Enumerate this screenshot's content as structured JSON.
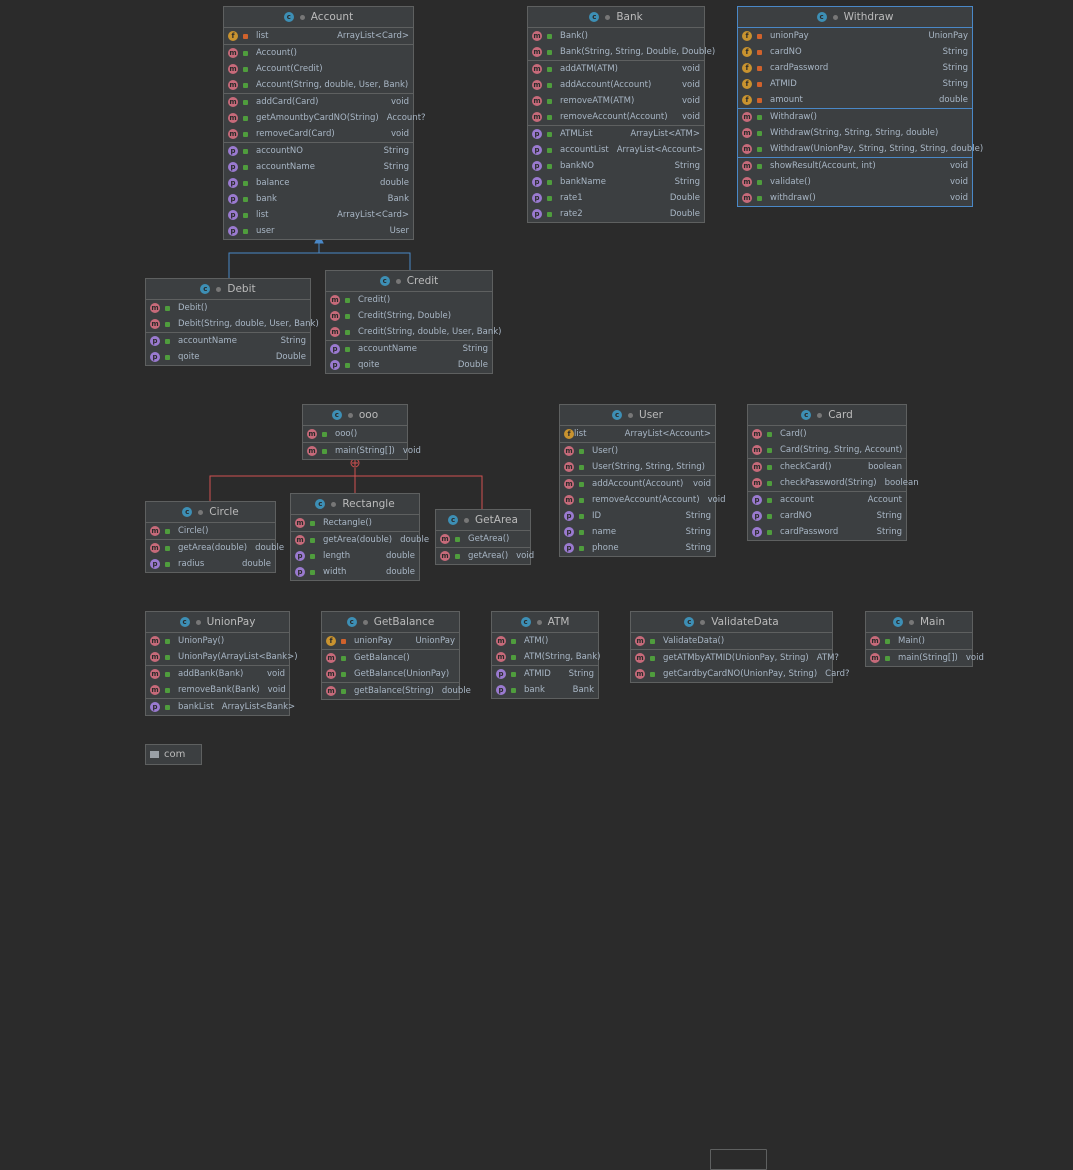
{
  "colors": {
    "background": "#2b2b2b",
    "box": "#3c3f41",
    "inheritance": "#4a88c7",
    "inner": "#d05050",
    "selection": "#4a88c7"
  },
  "classes": [
    {
      "id": "Account",
      "title": "Account",
      "sections": [
        [
          {
            "k": "f",
            "v": "priv",
            "name": "list",
            "type": "ArrayList<Card>"
          }
        ],
        [
          {
            "k": "m",
            "v": "pub",
            "name": "Account()",
            "type": ""
          },
          {
            "k": "m",
            "v": "pub",
            "name": "Account(Credit)",
            "type": ""
          },
          {
            "k": "m",
            "v": "pub",
            "name": "Account(String, double, User, Bank)",
            "type": ""
          }
        ],
        [
          {
            "k": "m",
            "v": "pub",
            "name": "addCard(Card)",
            "type": "void"
          },
          {
            "k": "m",
            "v": "pub",
            "name": "getAmountbyCardNO(String)",
            "type": "Account?"
          },
          {
            "k": "m",
            "v": "pub",
            "name": "removeCard(Card)",
            "type": "void"
          }
        ],
        [
          {
            "k": "p",
            "v": "pub",
            "name": "accountNO",
            "type": "String"
          },
          {
            "k": "p",
            "v": "pub",
            "name": "accountName",
            "type": "String"
          },
          {
            "k": "p",
            "v": "pub",
            "name": "balance",
            "type": "double"
          },
          {
            "k": "p",
            "v": "pub",
            "name": "bank",
            "type": "Bank"
          },
          {
            "k": "p",
            "v": "pub",
            "name": "list",
            "type": "ArrayList<Card>"
          },
          {
            "k": "p",
            "v": "pub",
            "name": "user",
            "type": "User"
          }
        ]
      ]
    },
    {
      "id": "Bank",
      "title": "Bank",
      "sections": [
        [
          {
            "k": "m",
            "v": "pub",
            "name": "Bank()",
            "type": ""
          },
          {
            "k": "m",
            "v": "pub",
            "name": "Bank(String, String, Double, Double)",
            "type": ""
          }
        ],
        [
          {
            "k": "m",
            "v": "pub",
            "name": "addATM(ATM)",
            "type": "void"
          },
          {
            "k": "m",
            "v": "pub",
            "name": "addAccount(Account)",
            "type": "void"
          },
          {
            "k": "m",
            "v": "pub",
            "name": "removeATM(ATM)",
            "type": "void"
          },
          {
            "k": "m",
            "v": "pub",
            "name": "removeAccount(Account)",
            "type": "void"
          }
        ],
        [
          {
            "k": "p",
            "v": "pub",
            "name": "ATMList",
            "type": "ArrayList<ATM>"
          },
          {
            "k": "p",
            "v": "pub",
            "name": "accountList",
            "type": "ArrayList<Account>"
          },
          {
            "k": "p",
            "v": "pub",
            "name": "bankNO",
            "type": "String"
          },
          {
            "k": "p",
            "v": "pub",
            "name": "bankName",
            "type": "String"
          },
          {
            "k": "p",
            "v": "pub",
            "name": "rate1",
            "type": "Double"
          },
          {
            "k": "p",
            "v": "pub",
            "name": "rate2",
            "type": "Double"
          }
        ]
      ]
    },
    {
      "id": "Withdraw",
      "title": "Withdraw",
      "selected": true,
      "sections": [
        [
          {
            "k": "f",
            "v": "priv",
            "name": "unionPay",
            "type": "UnionPay"
          },
          {
            "k": "f",
            "v": "priv",
            "name": "cardNO",
            "type": "String"
          },
          {
            "k": "f",
            "v": "priv",
            "name": "cardPassword",
            "type": "String"
          },
          {
            "k": "f",
            "v": "priv",
            "name": "ATMID",
            "type": "String"
          },
          {
            "k": "f",
            "v": "priv",
            "name": "amount",
            "type": "double"
          }
        ],
        [
          {
            "k": "m",
            "v": "pub",
            "name": "Withdraw()",
            "type": ""
          },
          {
            "k": "m",
            "v": "pub",
            "name": "Withdraw(String, String, String, double)",
            "type": ""
          },
          {
            "k": "m",
            "v": "pub",
            "name": "Withdraw(UnionPay, String, String, String, double)",
            "type": ""
          }
        ],
        [
          {
            "k": "m",
            "v": "pub",
            "name": "showResult(Account, int)",
            "type": "void"
          },
          {
            "k": "m",
            "v": "pub",
            "name": "validate()",
            "type": "void"
          },
          {
            "k": "m",
            "v": "pub",
            "name": "withdraw()",
            "type": "void"
          }
        ]
      ]
    },
    {
      "id": "Debit",
      "title": "Debit",
      "sections": [
        [
          {
            "k": "m",
            "v": "pub",
            "name": "Debit()",
            "type": ""
          },
          {
            "k": "m",
            "v": "pub",
            "name": "Debit(String, double, User, Bank)",
            "type": ""
          }
        ],
        [
          {
            "k": "p",
            "v": "pub",
            "name": "accountName",
            "type": "String"
          },
          {
            "k": "p",
            "v": "pub",
            "name": "qoite",
            "type": "Double"
          }
        ]
      ]
    },
    {
      "id": "Credit",
      "title": "Credit",
      "sections": [
        [
          {
            "k": "m",
            "v": "pub",
            "name": "Credit()",
            "type": ""
          },
          {
            "k": "m",
            "v": "pub",
            "name": "Credit(String, Double)",
            "type": ""
          },
          {
            "k": "m",
            "v": "pub",
            "name": "Credit(String, double, User, Bank)",
            "type": ""
          }
        ],
        [
          {
            "k": "p",
            "v": "pub",
            "name": "accountName",
            "type": "String"
          },
          {
            "k": "p",
            "v": "pub",
            "name": "qoite",
            "type": "Double"
          }
        ]
      ]
    },
    {
      "id": "ooo",
      "title": "ooo",
      "sections": [
        [
          {
            "k": "m",
            "v": "pub",
            "name": "ooo()",
            "type": ""
          }
        ],
        [
          {
            "k": "m",
            "v": "pub",
            "name": "main(String[])",
            "type": "void"
          }
        ]
      ]
    },
    {
      "id": "Circle",
      "title": "Circle",
      "sections": [
        [
          {
            "k": "m",
            "v": "pub",
            "name": "Circle()",
            "type": ""
          }
        ],
        [
          {
            "k": "m",
            "v": "pub",
            "name": "getArea(double)",
            "type": "double"
          },
          {
            "k": "p",
            "v": "pub",
            "name": "radius",
            "type": "double"
          }
        ]
      ]
    },
    {
      "id": "Rectangle",
      "title": "Rectangle",
      "sections": [
        [
          {
            "k": "m",
            "v": "pub",
            "name": "Rectangle()",
            "type": ""
          }
        ],
        [
          {
            "k": "m",
            "v": "pub",
            "name": "getArea(double)",
            "type": "double"
          },
          {
            "k": "p",
            "v": "pub",
            "name": "length",
            "type": "double"
          },
          {
            "k": "p",
            "v": "pub",
            "name": "width",
            "type": "double"
          }
        ]
      ]
    },
    {
      "id": "GetArea",
      "title": "GetArea",
      "sections": [
        [
          {
            "k": "m",
            "v": "pub",
            "name": "GetArea()",
            "type": ""
          }
        ],
        [
          {
            "k": "m",
            "v": "pub",
            "name": "getArea()",
            "type": "void"
          }
        ]
      ]
    },
    {
      "id": "User",
      "title": "User",
      "sections": [
        [
          {
            "k": "f",
            "v": "pkg",
            "name": "list",
            "type": "ArrayList<Account>"
          }
        ],
        [
          {
            "k": "m",
            "v": "pub",
            "name": "User()",
            "type": ""
          },
          {
            "k": "m",
            "v": "pub",
            "name": "User(String, String, String)",
            "type": ""
          }
        ],
        [
          {
            "k": "m",
            "v": "pub",
            "name": "addAccount(Account)",
            "type": "void"
          },
          {
            "k": "m",
            "v": "pub",
            "name": "removeAccount(Account)",
            "type": "void"
          },
          {
            "k": "p",
            "v": "pub",
            "name": "ID",
            "type": "String"
          },
          {
            "k": "p",
            "v": "pub",
            "name": "name",
            "type": "String"
          },
          {
            "k": "p",
            "v": "pub",
            "name": "phone",
            "type": "String"
          }
        ]
      ]
    },
    {
      "id": "Card",
      "title": "Card",
      "sections": [
        [
          {
            "k": "m",
            "v": "pub",
            "name": "Card()",
            "type": ""
          },
          {
            "k": "m",
            "v": "pub",
            "name": "Card(String, String, Account)",
            "type": ""
          }
        ],
        [
          {
            "k": "m",
            "v": "pub",
            "name": "checkCard()",
            "type": "boolean"
          },
          {
            "k": "m",
            "v": "pub",
            "name": "checkPassword(String)",
            "type": "boolean"
          }
        ],
        [
          {
            "k": "p",
            "v": "pub",
            "name": "account",
            "type": "Account"
          },
          {
            "k": "p",
            "v": "pub",
            "name": "cardNO",
            "type": "String"
          },
          {
            "k": "p",
            "v": "pub",
            "name": "cardPassword",
            "type": "String"
          }
        ]
      ]
    },
    {
      "id": "UnionPay",
      "title": "UnionPay",
      "sections": [
        [
          {
            "k": "m",
            "v": "pub",
            "name": "UnionPay()",
            "type": ""
          },
          {
            "k": "m",
            "v": "pub",
            "name": "UnionPay(ArrayList<Bank>)",
            "type": ""
          }
        ],
        [
          {
            "k": "m",
            "v": "pub",
            "name": "addBank(Bank)",
            "type": "void"
          },
          {
            "k": "m",
            "v": "pub",
            "name": "removeBank(Bank)",
            "type": "void"
          }
        ],
        [
          {
            "k": "p",
            "v": "pub",
            "name": "bankList",
            "type": "ArrayList<Bank>"
          }
        ]
      ]
    },
    {
      "id": "GetBalance",
      "title": "GetBalance",
      "sections": [
        [
          {
            "k": "f",
            "v": "priv",
            "name": "unionPay",
            "type": "UnionPay"
          }
        ],
        [
          {
            "k": "m",
            "v": "pub",
            "name": "GetBalance()",
            "type": ""
          },
          {
            "k": "m",
            "v": "pub",
            "name": "GetBalance(UnionPay)",
            "type": ""
          }
        ],
        [
          {
            "k": "m",
            "v": "pub",
            "name": "getBalance(String)",
            "type": "double"
          }
        ]
      ]
    },
    {
      "id": "ATM",
      "title": "ATM",
      "sections": [
        [
          {
            "k": "m",
            "v": "pub",
            "name": "ATM()",
            "type": ""
          },
          {
            "k": "m",
            "v": "pub",
            "name": "ATM(String, Bank)",
            "type": ""
          }
        ],
        [
          {
            "k": "p",
            "v": "pub",
            "name": "ATMID",
            "type": "String"
          },
          {
            "k": "p",
            "v": "pub",
            "name": "bank",
            "type": "Bank"
          }
        ]
      ]
    },
    {
      "id": "ValidateData",
      "title": "ValidateData",
      "sections": [
        [
          {
            "k": "m",
            "v": "pub",
            "name": "ValidateData()",
            "type": ""
          }
        ],
        [
          {
            "k": "m",
            "v": "pub",
            "name": "getATMbyATMID(UnionPay, String)",
            "type": "ATM?"
          },
          {
            "k": "m",
            "v": "pub",
            "name": "getCardbyCardNO(UnionPay, String)",
            "type": "Card?"
          }
        ]
      ]
    },
    {
      "id": "Main",
      "title": "Main",
      "sections": [
        [
          {
            "k": "m",
            "v": "pub",
            "name": "Main()",
            "type": ""
          }
        ],
        [
          {
            "k": "m",
            "v": "pub",
            "name": "main(String[])",
            "type": "void"
          }
        ]
      ]
    }
  ],
  "package": {
    "label": "com"
  }
}
